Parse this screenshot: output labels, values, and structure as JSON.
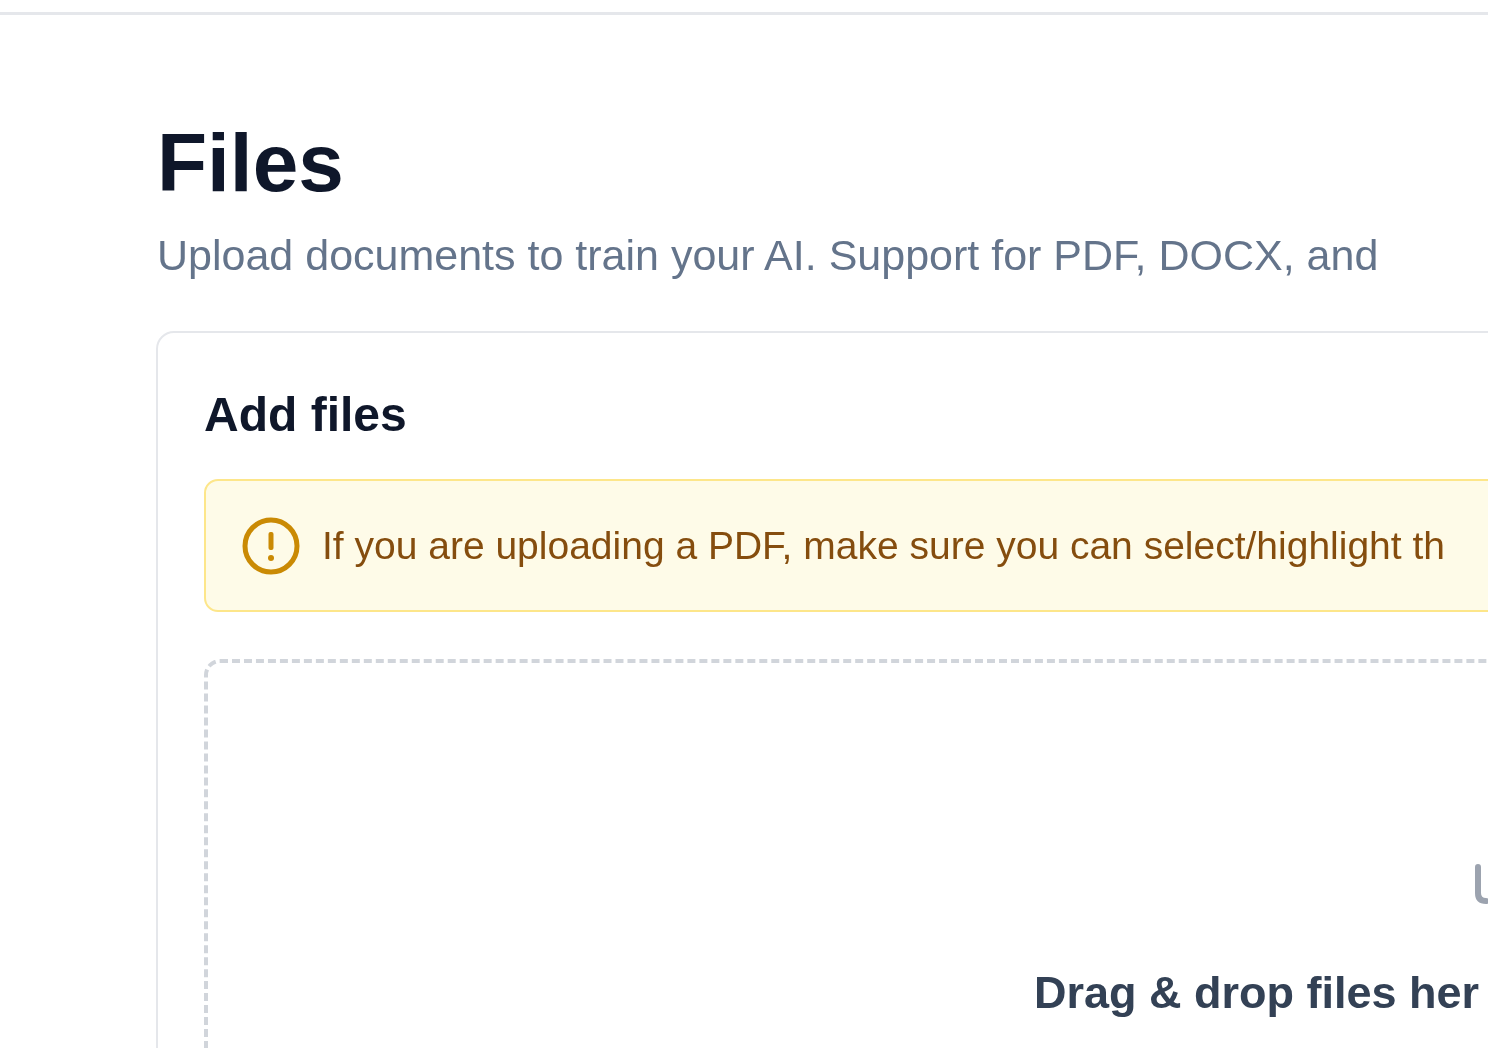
{
  "page": {
    "title": "Files",
    "subtitle": "Upload documents to train your AI. Support for PDF, DOCX, and"
  },
  "card": {
    "title": "Add files",
    "alert": {
      "kind": "warning",
      "text": "If you are uploading a PDF, make sure you can select/highlight th"
    },
    "dropzone": {
      "text": "Drag & drop files her"
    }
  }
}
